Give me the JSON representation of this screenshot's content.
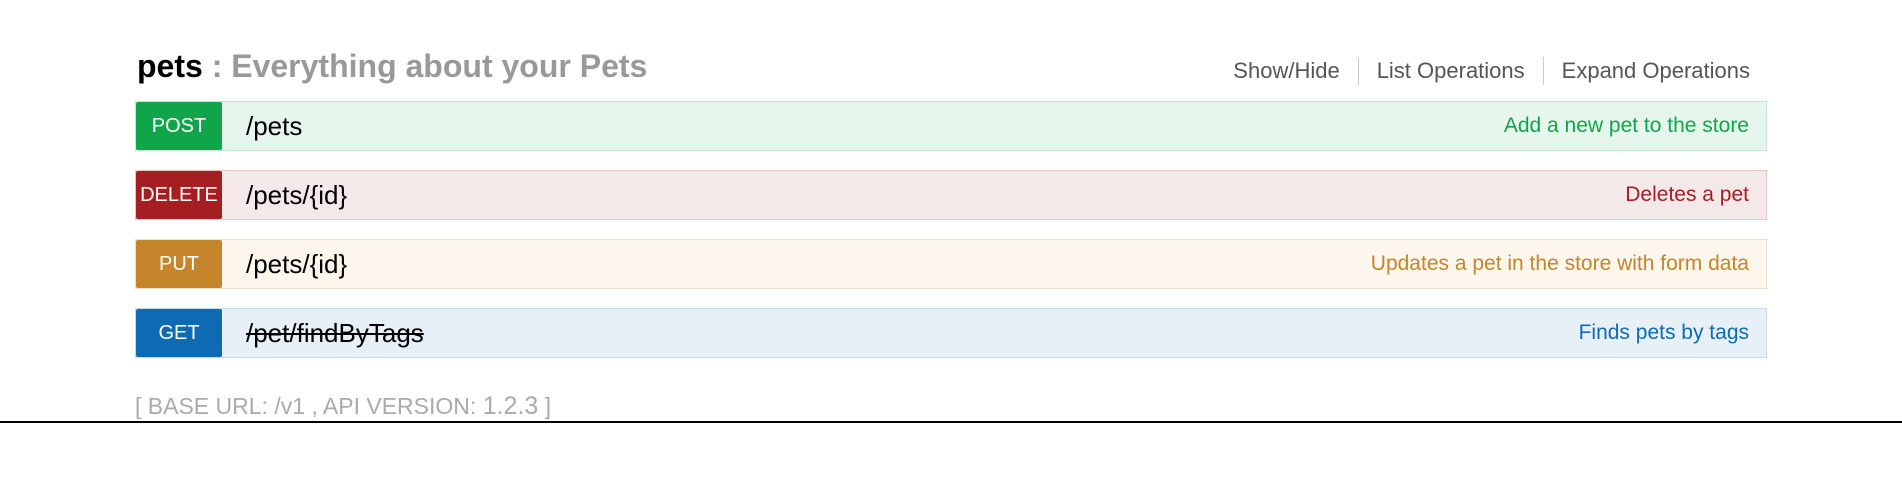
{
  "resource": {
    "name": "pets",
    "description": ": Everything about your Pets"
  },
  "options": {
    "show_hide": "Show/Hide",
    "list_operations": "List Operations",
    "expand_operations": "Expand Operations"
  },
  "operations": [
    {
      "method": "POST",
      "path": "/pets",
      "summary": "Add a new pet to the store",
      "deprecated": false,
      "colors": {
        "verb": "#10a54a",
        "bg": "#e7f6ec",
        "border": "#c3e8d1",
        "summary": "#10a54a"
      }
    },
    {
      "method": "DELETE",
      "path": "/pets/{id}",
      "summary": "Deletes a pet",
      "deprecated": false,
      "colors": {
        "verb": "#a41e22",
        "bg": "#f5e8e8",
        "border": "#e8c6c7",
        "summary": "#a41e22"
      }
    },
    {
      "method": "PUT",
      "path": "/pets/{id}",
      "summary": "Updates a pet in the store with form data",
      "deprecated": false,
      "colors": {
        "verb": "#c5862b",
        "bg": "#fcf6ed",
        "border": "#f0e0ca",
        "summary": "#c5862b"
      }
    },
    {
      "method": "GET",
      "path": "/pet/findByTags",
      "summary": "Finds pets by tags",
      "deprecated": true,
      "colors": {
        "verb": "#0f6ab4",
        "bg": "#e7f0f7",
        "border": "#c3d9ec",
        "summary": "#0f6ab4"
      }
    }
  ],
  "footer": {
    "open": "[ BASE URL: ",
    "base_url": "/v1",
    "mid": " , API VERSION: ",
    "version": "1.2.3",
    "close": " ]"
  }
}
